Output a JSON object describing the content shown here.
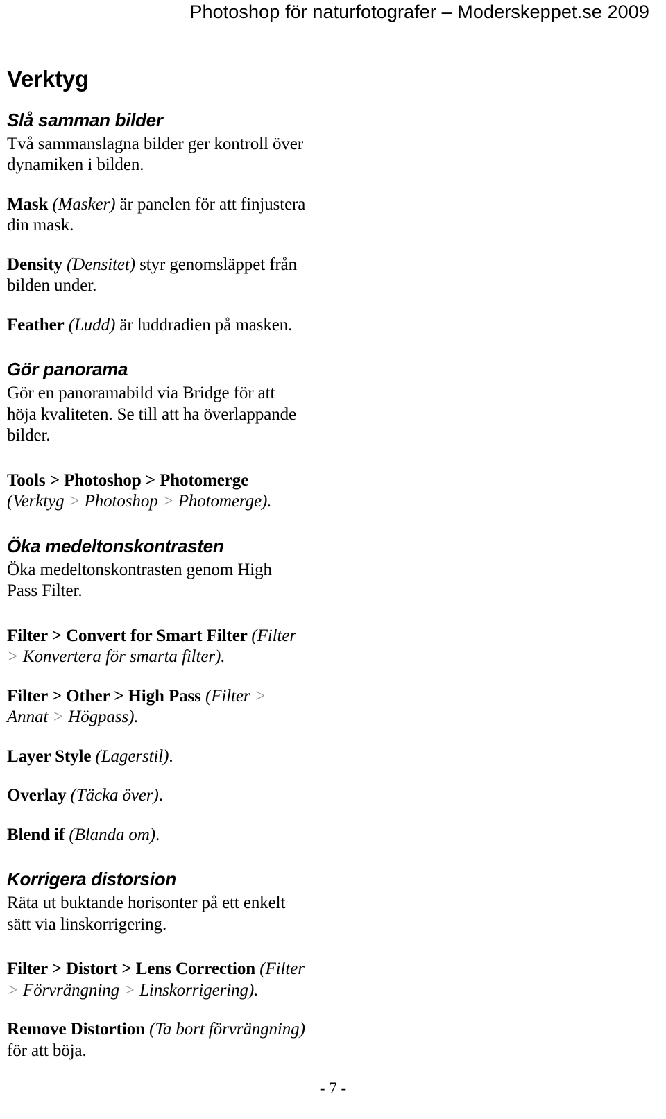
{
  "header": {
    "running_title": "Photoshop för naturfotografer – Moderskeppet.se 2009"
  },
  "chapter": {
    "title": "Verktyg"
  },
  "sections": [
    {
      "heading": "Slå samman bilder",
      "intro": "Två sammanslagna bilder ger kontroll över dynamiken i bilden.",
      "items": [
        {
          "term": "Mask",
          "sv": "(Masker)",
          "rest": " är panelen för att finjustera din mask."
        },
        {
          "term": "Density",
          "sv": "(Densitet)",
          "rest": " styr genomsläppet från bilden under."
        },
        {
          "term": "Feather",
          "sv": "(Ludd)",
          "rest": " är luddradien på masken."
        }
      ]
    },
    {
      "heading": "Gör panorama",
      "intro": "Gör en panoramabild via Bridge för att höja kvaliteten. Se till att ha överlappande bilder.",
      "menu_path": {
        "en": "Tools > Photoshop > Photomerge ",
        "sv_open": "(Verktyg",
        "sv_sep1": " > ",
        "sv_mid1": "Photoshop",
        "sv_sep2": " > ",
        "sv_close": "Photomerge)."
      }
    },
    {
      "heading": "Öka medeltonskontrasten",
      "intro": "Öka medeltonskontrasten genom High Pass Filter.",
      "paths": [
        {
          "en": "Filter > Convert for Smart Filter ",
          "sv_open": "(Filter",
          "sv_sep1": " > ",
          "sv_tail": "Konvertera för smarta filter)."
        },
        {
          "en": "Filter > Other > High Pass ",
          "sv_open": "(Filter",
          "sv_sep1": " > ",
          "sv_mid1": "Annat",
          "sv_sep2": " > ",
          "sv_tail": "Högpass)."
        }
      ],
      "items": [
        {
          "term": "Layer Style",
          "sv": "(Lagerstil)",
          "rest": "."
        },
        {
          "term": "Overlay",
          "sv": "(Täcka över)",
          "rest": "."
        },
        {
          "term": "Blend if",
          "sv": "(Blanda om)",
          "rest": "."
        }
      ]
    },
    {
      "heading": "Korrigera distorsion",
      "intro": "Räta ut buktande horisonter på ett enkelt sätt via linskorrigering.",
      "menu_path": {
        "en": "Filter > Distort > Lens Correction ",
        "sv_open": "(Filter",
        "sv_sep1": " > ",
        "sv_mid1": "Förvrängning",
        "sv_sep2": " > ",
        "sv_close": "Linskorrigering)."
      },
      "final_item": {
        "term": "Remove Distortion ",
        "sv": "(Ta bort förvrängning)",
        "rest": " för att böja."
      }
    }
  ],
  "footer": {
    "page_number": "- 7 -"
  }
}
